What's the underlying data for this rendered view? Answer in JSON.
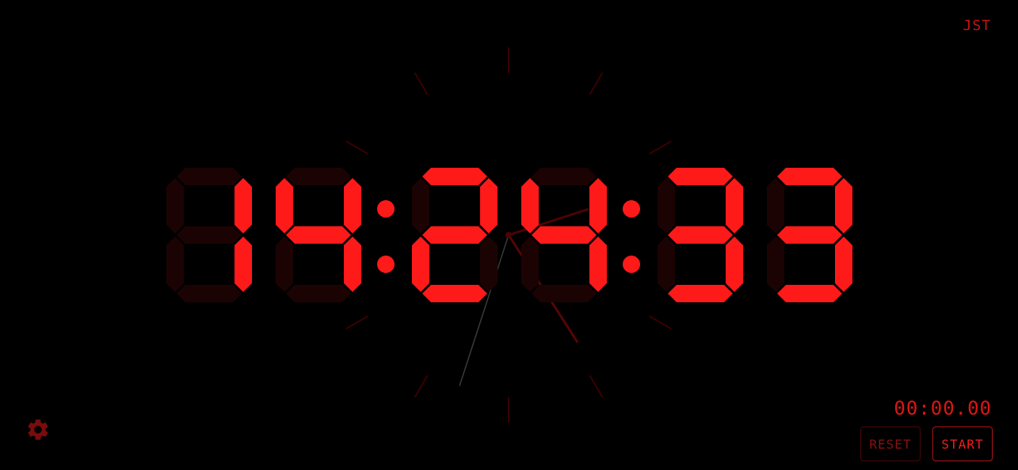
{
  "clock": {
    "digits": [
      "1",
      "4",
      "2",
      "4",
      "3",
      "3"
    ],
    "hour_unit": "h",
    "seconds": 33,
    "minutes": 24,
    "hours": 14
  },
  "timezone": "JST",
  "stopwatch": {
    "time": "00:00.00",
    "reset_label": "RESET",
    "start_label": "START"
  },
  "icons": {
    "settings": "gear-icon"
  },
  "colors": {
    "segment_on": "#ff1a1a",
    "segment_off": "#1c0303",
    "accent": "#e01414",
    "background": "#000000"
  }
}
